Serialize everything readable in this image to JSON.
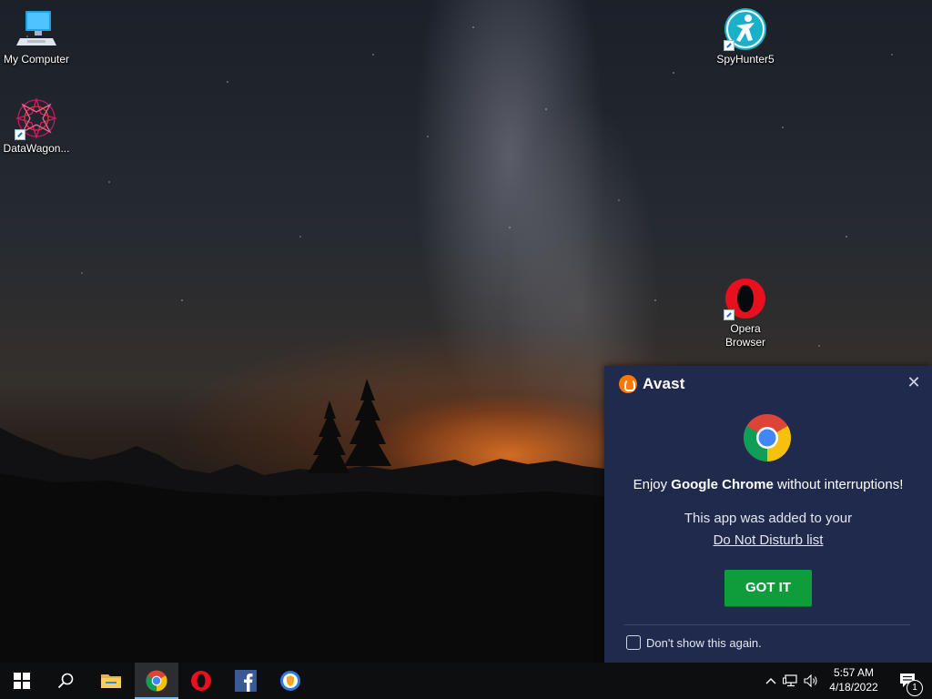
{
  "desktop": {
    "icons": [
      {
        "label": "My Computer"
      },
      {
        "label": "DataWagon..."
      },
      {
        "label": "SpyHunter5"
      },
      {
        "label": "Opera Browser"
      }
    ]
  },
  "notification": {
    "brand": "Avast",
    "message_prefix": "Enjoy ",
    "message_app": "Google Chrome",
    "message_suffix": " without interruptions!",
    "subtext": "This app was added to your",
    "link": "Do Not Disturb list",
    "button": "GOT IT",
    "checkbox_label": "Don't show this again.",
    "checkbox_checked": false,
    "accent_color": "#0f9c3b",
    "panel_color": "#1f2a4d"
  },
  "taskbar": {
    "items": [
      {
        "name": "Start",
        "icon": "windows-icon"
      },
      {
        "name": "Search",
        "icon": "search-icon"
      },
      {
        "name": "File Explorer",
        "icon": "folder-icon"
      },
      {
        "name": "Google Chrome",
        "icon": "chrome-icon",
        "active": true
      },
      {
        "name": "Opera",
        "icon": "opera-icon"
      },
      {
        "name": "Facebook",
        "icon": "facebook-icon"
      },
      {
        "name": "Avast Secure Browser",
        "icon": "secure-browser-icon"
      }
    ],
    "tray": {
      "time": "5:57 AM",
      "date": "4/18/2022",
      "notification_count": "1"
    }
  }
}
